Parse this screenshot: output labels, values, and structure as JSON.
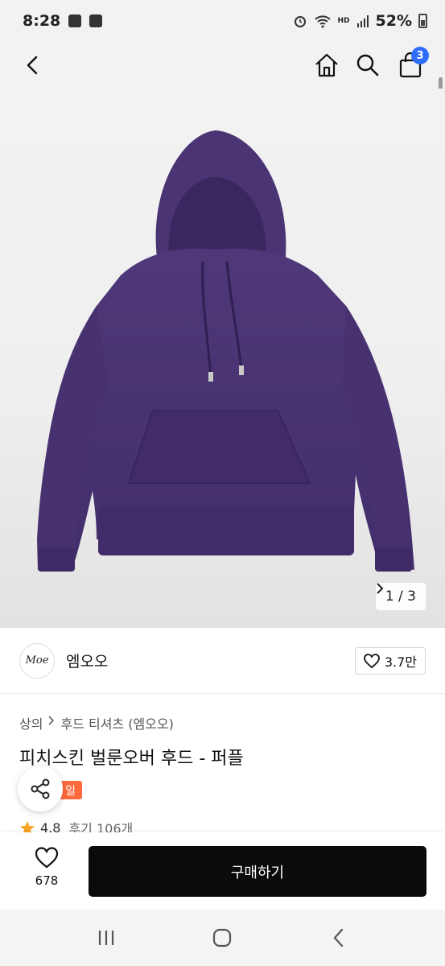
{
  "status_bar": {
    "time": "8:28",
    "network": "HD",
    "battery": "52%"
  },
  "header": {
    "cart_count": "3"
  },
  "gallery": {
    "counter": "1 / 3",
    "product_color": "#4b3576"
  },
  "brand": {
    "logo_text": "Moe",
    "name": "엠오오",
    "likes": "3.7만"
  },
  "breadcrumb": {
    "category": "상의",
    "subcategory": "후드 티셔츠 (엠오오)"
  },
  "product": {
    "title": "피치스킨 벌룬오버 후드 - 퍼플",
    "badge": "일",
    "rating": "4.8",
    "reviews": "후기 106개"
  },
  "bottom_bar": {
    "wish_count": "678",
    "buy_label": "구매하기"
  },
  "colors": {
    "accent_blue": "#2f6dff",
    "sale_orange": "#ff6a3d",
    "buy_black": "#0b0b0b",
    "star": "#f5a623"
  }
}
